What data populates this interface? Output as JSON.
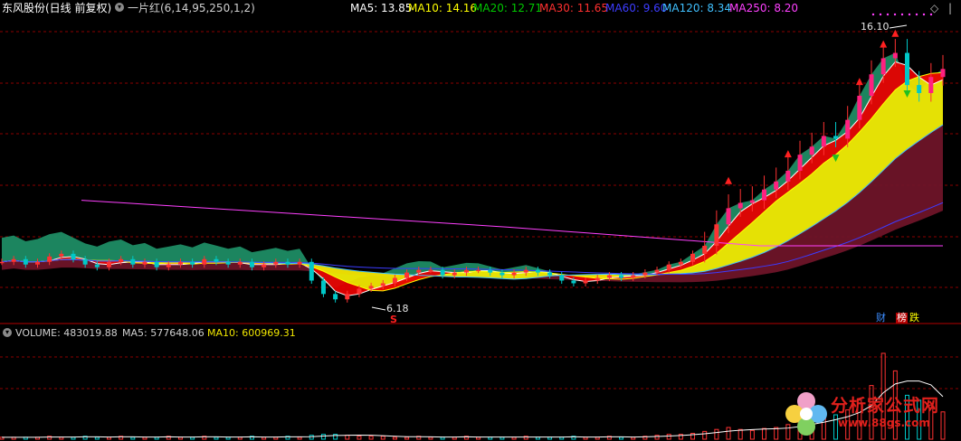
{
  "header": {
    "title": "东风股份(日线 前复权)",
    "indicator": "一片红(6,14,95,250,1,2)",
    "ma": [
      {
        "label": "MA5: 13.85",
        "color": "#ffffff"
      },
      {
        "label": "MA10: 14.16",
        "color": "#ffff00"
      },
      {
        "label": "MA20: 12.71",
        "color": "#00c800"
      },
      {
        "label": "MA30: 11.65",
        "color": "#ff3030"
      },
      {
        "label": "MA60: 9.60",
        "color": "#3c3cff"
      },
      {
        "label": "MA120: 8.34",
        "color": "#40c0ff"
      },
      {
        "label": "MA250: 8.20",
        "color": "#ff40ff"
      }
    ],
    "collapse_icon": "chevron-down-icon",
    "corner_icons": [
      "diamond-icon",
      "vertical-bar-icon"
    ]
  },
  "price_panel": {
    "high_label": "16.10",
    "low_label": "6.18",
    "signal_mark": "S",
    "tags": [
      "财",
      "榜",
      "跌"
    ]
  },
  "volume_panel": {
    "volume_label": "VOLUME: 483019.88",
    "ma5_label": "MA5: 577648.06",
    "ma10_label": "MA10: 600969.31"
  },
  "watermark": {
    "main": "分析家公式网",
    "url": "www.88gs.com"
  },
  "colors": {
    "up": "#ff3232",
    "down": "#00c8c8",
    "ribbon_green": "#1e8c64",
    "ribbon_red": "#e60000",
    "ribbon_yellow": "#f0e600",
    "ribbon_maroon": "#6e1428",
    "grid": "#8c0000"
  },
  "chart_data": {
    "type": "candlestick",
    "ymin": 5.5,
    "ymax": 16.7,
    "marked_high": 16.1,
    "marked_low": 6.18,
    "series": [
      {
        "name": "MA5",
        "value": 13.85
      },
      {
        "name": "MA10",
        "value": 14.16
      },
      {
        "name": "MA20",
        "value": 12.71
      },
      {
        "name": "MA30",
        "value": 11.65
      },
      {
        "name": "MA60",
        "value": 9.6
      },
      {
        "name": "MA120",
        "value": 8.34
      },
      {
        "name": "MA250",
        "value": 8.2
      }
    ],
    "close_trend": [
      7.6,
      7.7,
      7.5,
      7.6,
      7.8,
      7.9,
      7.7,
      7.5,
      7.4,
      7.6,
      7.7,
      7.5,
      7.6,
      7.4,
      7.5,
      7.6,
      7.5,
      7.7,
      7.6,
      7.5,
      7.6,
      7.4,
      7.5,
      7.6,
      7.5,
      7.6,
      6.9,
      6.4,
      6.2,
      6.4,
      6.6,
      6.7,
      6.8,
      7.0,
      7.2,
      7.3,
      7.3,
      7.1,
      7.2,
      7.3,
      7.3,
      7.2,
      7.1,
      7.2,
      7.3,
      7.2,
      7.1,
      6.9,
      6.8,
      6.9,
      7.0,
      7.1,
      7.0,
      7.1,
      7.2,
      7.3,
      7.5,
      7.6,
      7.9,
      8.2,
      9.0,
      9.6,
      9.8,
      9.9,
      10.3,
      10.6,
      11.0,
      11.6,
      11.9,
      12.3,
      12.2,
      12.9,
      13.8,
      14.6,
      15.2,
      15.4,
      14.2,
      13.9,
      14.5,
      14.8
    ],
    "volume_ratio": [
      0.02,
      0.02,
      0.02,
      0.02,
      0.03,
      0.02,
      0.02,
      0.03,
      0.02,
      0.02,
      0.03,
      0.02,
      0.02,
      0.02,
      0.03,
      0.02,
      0.02,
      0.03,
      0.02,
      0.02,
      0.02,
      0.03,
      0.02,
      0.02,
      0.03,
      0.02,
      0.04,
      0.05,
      0.05,
      0.04,
      0.03,
      0.03,
      0.03,
      0.02,
      0.02,
      0.03,
      0.02,
      0.02,
      0.02,
      0.03,
      0.02,
      0.02,
      0.02,
      0.02,
      0.03,
      0.02,
      0.02,
      0.02,
      0.03,
      0.02,
      0.02,
      0.03,
      0.02,
      0.02,
      0.03,
      0.04,
      0.05,
      0.05,
      0.06,
      0.08,
      0.1,
      0.12,
      0.1,
      0.09,
      0.11,
      0.12,
      0.15,
      0.18,
      0.2,
      0.22,
      0.25,
      0.3,
      0.4,
      0.55,
      0.88,
      0.7,
      0.45,
      0.4,
      0.35,
      0.28
    ]
  }
}
